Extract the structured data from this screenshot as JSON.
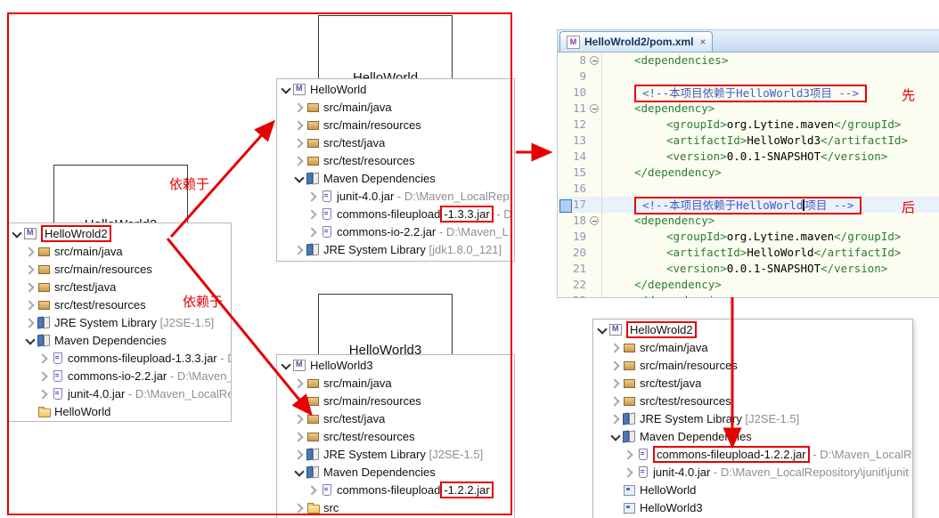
{
  "colors": {
    "annotation_red": "#e60000",
    "xml_tag_green": "#2e7d32",
    "xml_comment_blue": "#3f5fbf",
    "editor_bg": "#fbfdf0"
  },
  "annotations": {
    "depends_1": "依赖于",
    "depends_2": "依赖于"
  },
  "node_boxes": {
    "helloworld": "HelloWorld",
    "helloworld2": "HelloWorld2",
    "helloworld3": "HelloWorld3"
  },
  "editor": {
    "tab_title": "HelloWrold2/pom.xml",
    "tab_icon": "M",
    "close_icon": "×",
    "lines": [
      {
        "num": "8",
        "fold": true,
        "indent": 2,
        "parts": [
          {
            "t": "tag",
            "v": "<dependencies>"
          }
        ]
      },
      {
        "num": "9",
        "indent": 0,
        "parts": []
      },
      {
        "num": "10",
        "indent": 2,
        "boxed": true,
        "note": "先",
        "parts": [
          {
            "t": "comment",
            "v": "<!--本项目依赖于HelloWorld3项目 -->"
          }
        ]
      },
      {
        "num": "11",
        "fold": true,
        "indent": 2,
        "parts": [
          {
            "t": "tag",
            "v": "<dependency>"
          }
        ]
      },
      {
        "num": "12",
        "indent": 4,
        "parts": [
          {
            "t": "tag",
            "v": "<groupId>"
          },
          {
            "t": "text",
            "v": "org.Lytine.maven"
          },
          {
            "t": "tag",
            "v": "</groupId>"
          }
        ]
      },
      {
        "num": "13",
        "indent": 4,
        "parts": [
          {
            "t": "tag",
            "v": "<artifactId>"
          },
          {
            "t": "text",
            "v": "HelloWorld3"
          },
          {
            "t": "tag",
            "v": "</artifactId>"
          }
        ]
      },
      {
        "num": "14",
        "indent": 4,
        "parts": [
          {
            "t": "tag",
            "v": "<version>"
          },
          {
            "t": "text",
            "v": "0.0.1-SNAPSHOT"
          },
          {
            "t": "tag",
            "v": "</version>"
          }
        ]
      },
      {
        "num": "15",
        "indent": 2,
        "parts": [
          {
            "t": "tag",
            "v": "</dependency>"
          }
        ]
      },
      {
        "num": "16",
        "indent": 0,
        "parts": []
      },
      {
        "num": "17",
        "indent": 2,
        "boxed": true,
        "note": "后",
        "current": true,
        "parts": [
          {
            "t": "comment",
            "v": "<!--本项目依赖于HelloWorld"
          },
          {
            "t": "caret"
          },
          {
            "t": "comment",
            "v": "项目 -->"
          }
        ]
      },
      {
        "num": "18",
        "fold": true,
        "indent": 2,
        "parts": [
          {
            "t": "tag",
            "v": "<dependency>"
          }
        ]
      },
      {
        "num": "19",
        "indent": 4,
        "parts": [
          {
            "t": "tag",
            "v": "<groupId>"
          },
          {
            "t": "text",
            "v": "org.Lytine.maven"
          },
          {
            "t": "tag",
            "v": "</groupId>"
          }
        ]
      },
      {
        "num": "20",
        "indent": 4,
        "parts": [
          {
            "t": "tag",
            "v": "<artifactId>"
          },
          {
            "t": "text",
            "v": "HelloWorld"
          },
          {
            "t": "tag",
            "v": "</artifactId>"
          }
        ]
      },
      {
        "num": "21",
        "indent": 4,
        "parts": [
          {
            "t": "tag",
            "v": "<version>"
          },
          {
            "t": "text",
            "v": "0.0.1-SNAPSHOT"
          },
          {
            "t": "tag",
            "v": "</version>"
          }
        ]
      },
      {
        "num": "22",
        "indent": 2,
        "parts": [
          {
            "t": "tag",
            "v": "</dependency>"
          }
        ]
      },
      {
        "num": "23",
        "indent": 2,
        "parts": [
          {
            "t": "tag",
            "v": "</dependencies>"
          }
        ]
      }
    ]
  },
  "trees": {
    "helloworld2": {
      "items": [
        {
          "indent": 0,
          "arrow": "expanded",
          "icon": "maven-project",
          "label": "HelloWrold2",
          "redbox": true
        },
        {
          "indent": 1,
          "arrow": "collapsed",
          "icon": "package",
          "label": "src/main/java"
        },
        {
          "indent": 1,
          "arrow": "collapsed",
          "icon": "package",
          "label": "src/main/resources"
        },
        {
          "indent": 1,
          "arrow": "collapsed",
          "icon": "package",
          "label": "src/test/java"
        },
        {
          "indent": 1,
          "arrow": "collapsed",
          "icon": "package",
          "label": "src/test/resources"
        },
        {
          "indent": 1,
          "arrow": "collapsed",
          "icon": "library",
          "label": "JRE System Library",
          "suffix": " [J2SE-1.5]"
        },
        {
          "indent": 1,
          "arrow": "expanded",
          "icon": "library",
          "label": "Maven Dependencies"
        },
        {
          "indent": 2,
          "arrow": "collapsed",
          "icon": "jar",
          "label": "commons-fileupload-1.3.3.jar",
          "suffix": " - D"
        },
        {
          "indent": 2,
          "arrow": "collapsed",
          "icon": "jar",
          "label": "commons-io-2.2.jar",
          "suffix": " - D:\\Maven_L"
        },
        {
          "indent": 2,
          "arrow": "collapsed",
          "icon": "jar",
          "label": "junit-4.0.jar",
          "suffix": " - D:\\Maven_LocalRep"
        },
        {
          "indent": 1,
          "arrow": "none",
          "icon": "folder",
          "label": "HelloWorld"
        }
      ]
    },
    "helloworld": {
      "items": [
        {
          "indent": 0,
          "arrow": "expanded",
          "icon": "maven-project",
          "label": "HelloWorld"
        },
        {
          "indent": 1,
          "arrow": "collapsed",
          "icon": "package",
          "label": "src/main/java"
        },
        {
          "indent": 1,
          "arrow": "collapsed",
          "icon": "package",
          "label": "src/main/resources"
        },
        {
          "indent": 1,
          "arrow": "collapsed",
          "icon": "package",
          "label": "src/test/java"
        },
        {
          "indent": 1,
          "arrow": "collapsed",
          "icon": "package",
          "label": "src/test/resources"
        },
        {
          "indent": 1,
          "arrow": "expanded",
          "icon": "library",
          "label": "Maven Dependencies"
        },
        {
          "indent": 2,
          "arrow": "collapsed",
          "icon": "jar",
          "label": "junit-4.0.jar",
          "suffix": " - D:\\Maven_LocalRep"
        },
        {
          "indent": 2,
          "arrow": "collapsed",
          "icon": "jar",
          "prefix": "commons-fileupload",
          "boxed": "-1.3.3.jar",
          "suffix": " - D"
        },
        {
          "indent": 2,
          "arrow": "collapsed",
          "icon": "jar",
          "label": "commons-io-2.2.jar",
          "suffix": " - D:\\Maven_L"
        },
        {
          "indent": 1,
          "arrow": "collapsed",
          "icon": "library",
          "label": "JRE System Library",
          "suffix": " [jdk1.8.0_121]"
        }
      ]
    },
    "helloworld3": {
      "items": [
        {
          "indent": 0,
          "arrow": "expanded",
          "icon": "maven-project",
          "label": "HelloWorld3"
        },
        {
          "indent": 1,
          "arrow": "collapsed",
          "icon": "package",
          "label": "src/main/java"
        },
        {
          "indent": 1,
          "arrow": "collapsed",
          "icon": "package",
          "label": "src/main/resources"
        },
        {
          "indent": 1,
          "arrow": "collapsed",
          "icon": "package",
          "label": "src/test/java"
        },
        {
          "indent": 1,
          "arrow": "collapsed",
          "icon": "package",
          "label": "src/test/resources"
        },
        {
          "indent": 1,
          "arrow": "collapsed",
          "icon": "library",
          "label": "JRE System Library",
          "suffix": " [J2SE-1.5]"
        },
        {
          "indent": 1,
          "arrow": "expanded",
          "icon": "library",
          "label": "Maven Dependencies"
        },
        {
          "indent": 2,
          "arrow": "collapsed",
          "icon": "jar",
          "prefix": "commons-fileupload",
          "boxed": "-1.2.2.jar"
        },
        {
          "indent": 1,
          "arrow": "collapsed",
          "icon": "folder",
          "label": "src"
        }
      ]
    },
    "helloworld2_after": {
      "items": [
        {
          "indent": 0,
          "arrow": "expanded",
          "icon": "maven-project",
          "label": "HelloWrold2",
          "redbox": true
        },
        {
          "indent": 1,
          "arrow": "collapsed",
          "icon": "package",
          "label": "src/main/java"
        },
        {
          "indent": 1,
          "arrow": "collapsed",
          "icon": "package",
          "label": "src/main/resources"
        },
        {
          "indent": 1,
          "arrow": "collapsed",
          "icon": "package",
          "label": "src/test/java"
        },
        {
          "indent": 1,
          "arrow": "collapsed",
          "icon": "package",
          "label": "src/test/resources"
        },
        {
          "indent": 1,
          "arrow": "collapsed",
          "icon": "library",
          "label": "JRE System Library",
          "suffix": " [J2SE-1.5]"
        },
        {
          "indent": 1,
          "arrow": "expanded",
          "icon": "library",
          "label": "Maven Dependencies"
        },
        {
          "indent": 2,
          "arrow": "collapsed",
          "icon": "jar",
          "boxed": "commons-fileupload-1.2.2.jar",
          "suffix": " - D:\\Maven_LocalR"
        },
        {
          "indent": 2,
          "arrow": "collapsed",
          "icon": "jar",
          "label": "junit-4.0.jar",
          "suffix": " - D:\\Maven_LocalRepository\\junit\\junit"
        },
        {
          "indent": 1,
          "arrow": "none",
          "icon": "project",
          "label": "HelloWorld"
        },
        {
          "indent": 1,
          "arrow": "none",
          "icon": "project",
          "label": "HelloWorld3"
        }
      ]
    }
  }
}
